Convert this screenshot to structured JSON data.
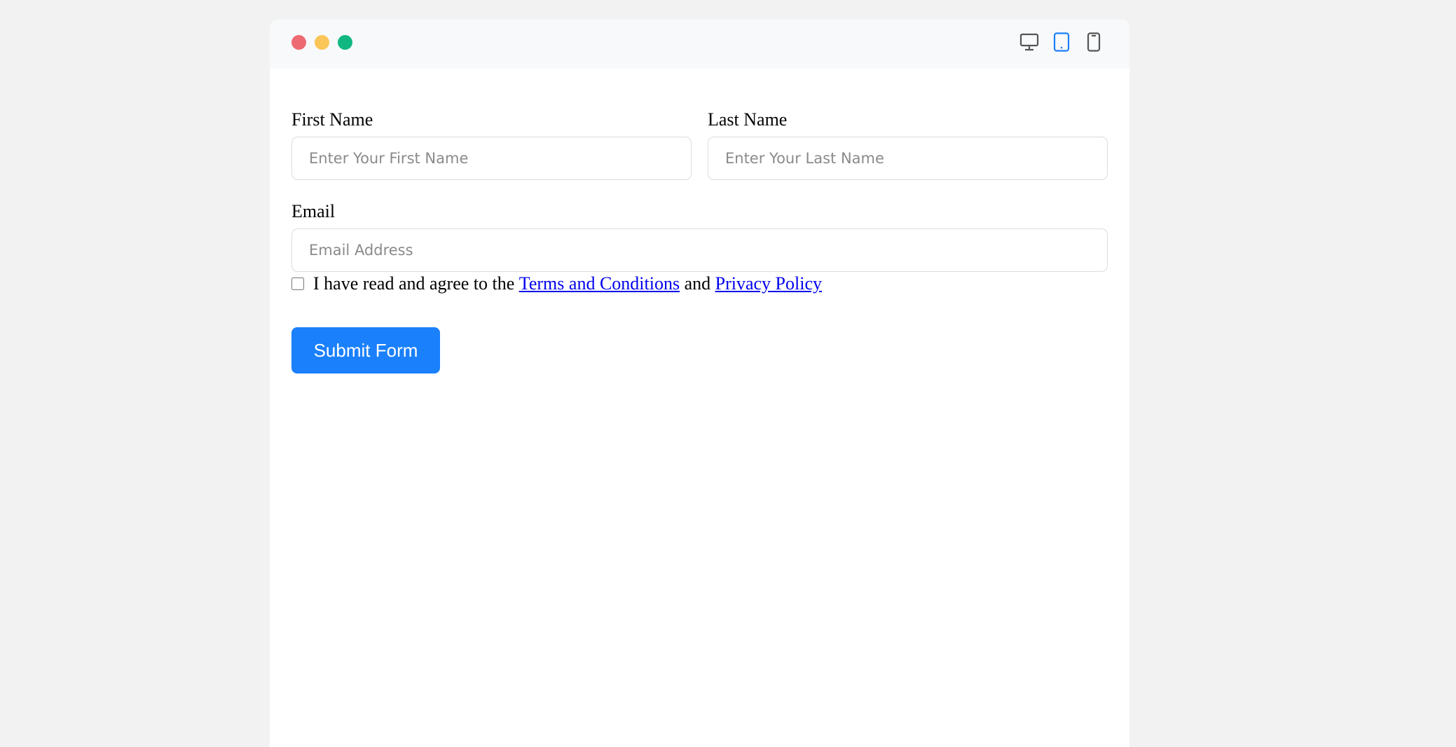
{
  "titlebar": {
    "window_controls": [
      {
        "name": "close",
        "color": "#ee6a73"
      },
      {
        "name": "minimize",
        "color": "#fac657"
      },
      {
        "name": "maximize",
        "color": "#10b781"
      }
    ],
    "device_toggles": [
      {
        "icon": "desktop-icon",
        "active": false
      },
      {
        "icon": "tablet-icon",
        "active": true
      },
      {
        "icon": "mobile-icon",
        "active": false
      }
    ],
    "active_color": "#1a80fb",
    "inactive_color": "#555555"
  },
  "form": {
    "first_name": {
      "label": "First Name",
      "placeholder": "Enter Your First Name",
      "value": ""
    },
    "last_name": {
      "label": "Last Name",
      "placeholder": "Enter Your Last Name",
      "value": ""
    },
    "email": {
      "label": "Email",
      "placeholder": "Email Address",
      "value": ""
    },
    "consent": {
      "checked": false,
      "text_before": "I have read and agree to the",
      "terms_link": "Terms and Conditions",
      "text_middle": "and",
      "privacy_link": "Privacy Policy"
    },
    "submit_label": "Submit Form"
  }
}
